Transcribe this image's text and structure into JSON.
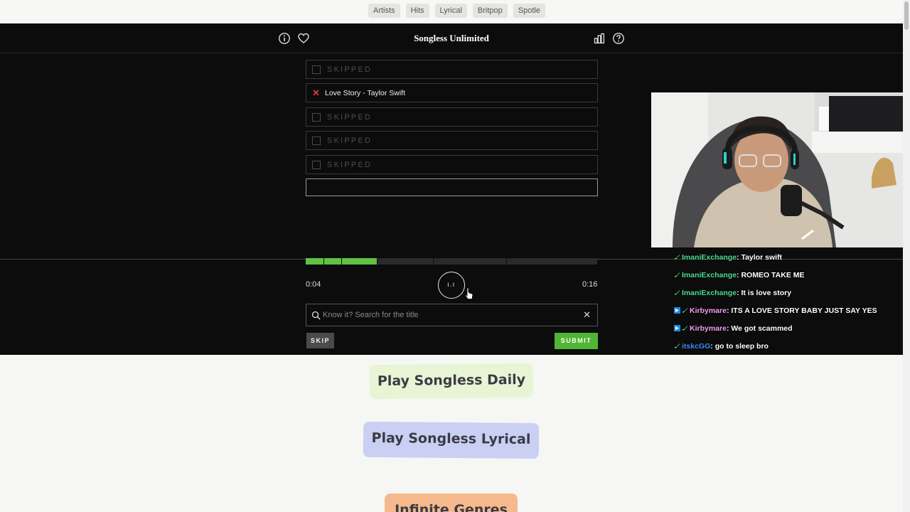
{
  "tags": [
    "Artists",
    "Hits",
    "Lyrical",
    "Britpop",
    "Spotle"
  ],
  "header": {
    "title": "Songless Unlimited"
  },
  "guesses": [
    {
      "status": "skipped",
      "text": "SKIPPED"
    },
    {
      "status": "wrong",
      "text": "Love Story - Taylor Swift"
    },
    {
      "status": "skipped",
      "text": "SKIPPED"
    },
    {
      "status": "skipped",
      "text": "SKIPPED"
    },
    {
      "status": "skipped",
      "text": "SKIPPED"
    },
    {
      "status": "current",
      "text": ""
    }
  ],
  "player": {
    "current_time": "0:04",
    "total_time": "0:16",
    "progress_fraction": 0.245,
    "unlocked_fraction": 0.245,
    "play_glyph": "ı.ı",
    "colors": {
      "progress": "#5fc242",
      "accent_submit": "#4fb533",
      "wrong": "#e03636"
    }
  },
  "search": {
    "placeholder": "Know it? Search for the title",
    "value": ""
  },
  "buttons": {
    "skip": "SKIP",
    "submit": "SUBMIT"
  },
  "chat": [
    {
      "user": "ImaniExchange",
      "color": "#4fdc8f",
      "text": "Taylor swift",
      "badges": [
        "sword"
      ]
    },
    {
      "user": "ImaniExchange",
      "color": "#4fdc8f",
      "text": "ROMEO TAKE ME",
      "badges": [
        "sword"
      ]
    },
    {
      "user": "ImaniExchange",
      "color": "#4fdc8f",
      "text": "It is love story",
      "badges": [
        "sword"
      ]
    },
    {
      "user": "Kirbymare",
      "color": "#f0a0f0",
      "text": "ITS A LOVE STORY BABY JUST SAY YES",
      "badges": [
        "prime",
        "sword"
      ]
    },
    {
      "user": "Kirbymare",
      "color": "#f0a0f0",
      "text": "We got scammed",
      "badges": [
        "prime",
        "sword"
      ]
    },
    {
      "user": "itskcGG",
      "color": "#3a8dff",
      "text": "go to sleep bro",
      "badges": [
        "sword"
      ]
    }
  ],
  "links": {
    "daily": "Play Songless Daily",
    "lyrical": "Play Songless Lyrical",
    "genres": "Infinite Genres"
  },
  "icons": {
    "info": "info-icon",
    "heart": "heart-icon",
    "stats": "bar-chart-icon",
    "help": "help-icon",
    "search": "search-icon",
    "clear": "close-icon"
  }
}
